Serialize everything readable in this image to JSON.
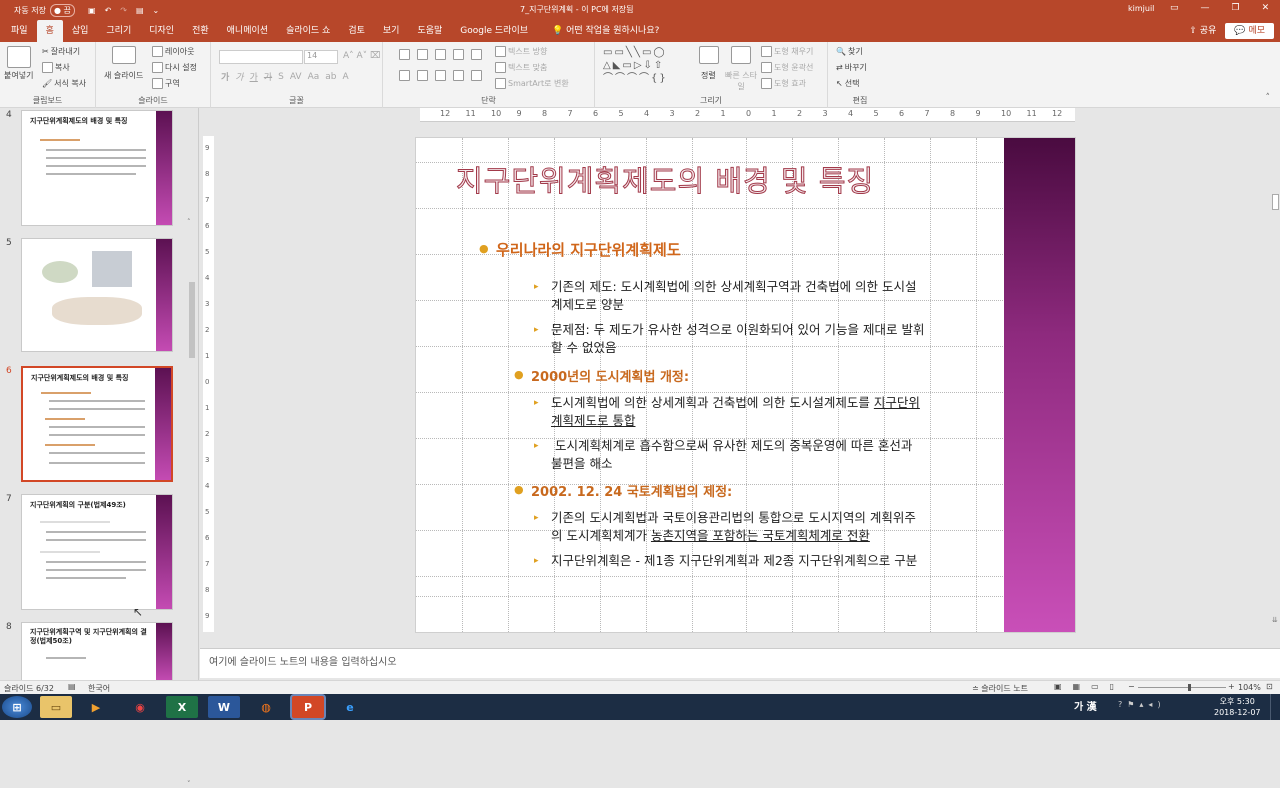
{
  "titlebar": {
    "autosave": "자동 저장",
    "autosave_state": "● 끔",
    "doc": "7_지구단위계획 - 이 PC에 저장됨",
    "user": "kimjuil"
  },
  "tabs": [
    "파일",
    "홈",
    "삽입",
    "그리기",
    "디자인",
    "전환",
    "애니메이션",
    "슬라이드 쇼",
    "검토",
    "보기",
    "도움말",
    "Google 드라이브"
  ],
  "tell_me": "어떤 작업을 원하시나요?",
  "share": "공유",
  "memo": "메모",
  "ribbon": {
    "paste": "붙여넣기",
    "cut": "잘라내기",
    "copy": "복사",
    "format_painter": "서식 복사",
    "clipboard": "클립보드",
    "new_slide": "새 슬라이드",
    "layout": "레이아웃",
    "reset": "다시 설정",
    "section": "구역",
    "slides": "슬라이드",
    "font_size": "14",
    "font": "글꼴",
    "text_dir": "텍스트 방향",
    "align_text": "텍스트 맞춤",
    "smartart": "SmartArt로 변환",
    "paragraph": "단락",
    "arrange": "정렬",
    "quick_styles": "빠른 스타일",
    "shape_fill": "도형 채우기",
    "shape_outline": "도형 윤곽선",
    "shape_effects": "도형 효과",
    "drawing": "그리기",
    "find": "찾기",
    "replace": "바꾸기",
    "select": "선택",
    "editing": "편집"
  },
  "ruler_h": [
    "12",
    "11",
    "10",
    "9",
    "8",
    "7",
    "6",
    "5",
    "4",
    "3",
    "2",
    "1",
    "0",
    "1",
    "2",
    "3",
    "4",
    "5",
    "6",
    "7",
    "8",
    "9",
    "10",
    "11",
    "12"
  ],
  "ruler_v": [
    "9",
    "8",
    "7",
    "6",
    "5",
    "4",
    "3",
    "2",
    "1",
    "0",
    "1",
    "2",
    "3",
    "4",
    "5",
    "6",
    "7",
    "8",
    "9"
  ],
  "thumbs": [
    {
      "num": "4",
      "title": "지구단위계획제도의 배경 및 특징"
    },
    {
      "num": "5",
      "title": ""
    },
    {
      "num": "6",
      "title": "지구단위계획제도의 배경 및 특징"
    },
    {
      "num": "7",
      "title": "지구단위계획의 구분(법제49조)"
    },
    {
      "num": "8",
      "title": "지구단위계획구역 및 지구단위계획의 결정(법제50조)"
    }
  ],
  "slide": {
    "title": "지구단위계획제도의 배경 및 특징",
    "h1": "우리나라의 지구단위계획제도",
    "p1a": "기존의 제도: 도시계획법에 의한 상세계획구역과 건축법에 의한 도시설",
    "p1b": "계제도로 양분",
    "p2a": "문제점: 두 제도가 유사한 성격으로 이원화되어 있어 기능을 제대로 발휘",
    "p2b": "할 수 없었음",
    "h2": "2000년의 도시계획법 개정:",
    "p3a": "도시계획법에 의한 상세계획과 건축법에 의한 도시설계제도를 ",
    "p3u1": "지구단위",
    "p3u2": "계획제도로 통합",
    "p4a": " 도시계획체계로 흡수함으로써 유사한 제도의 중복운영에 따른 혼선과",
    "p4b": "불편을 해소",
    "h3": "2002. 12. 24 국토계획법의 제정:",
    "p5a": "기존의 도시계획법과 국토이용관리법의 통합으로 도시지역의 계획위주",
    "p5b": "의 도시계획체계가 ",
    "p5u": "농촌지역을 포함하는 국토계획체계로 전환",
    "p6": "지구단위계획은 - 제1종 지구단위계획과 제2종 지구단위계획으로 구분"
  },
  "notes": "여기에 슬라이드 노트의 내용을 입력하십시오",
  "status": {
    "slide": "슬라이드 6/32",
    "lang": "한국어",
    "notes_btn": "슬라이드 노트",
    "zoom": "104%"
  },
  "taskbar": {
    "ime": "가 漢",
    "time": "오후 5:30",
    "date": "2018-12-07"
  }
}
